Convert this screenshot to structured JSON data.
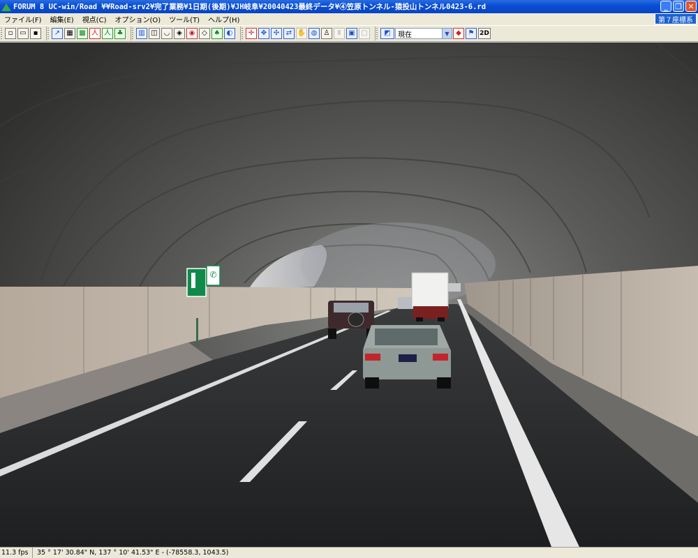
{
  "window": {
    "title": "FORUM 8    UC-win/Road    ¥¥Road-srv2¥完了業務¥1日期(後期)¥JH岐阜¥20040423最終データ¥④笠原トンネル-猿投山トンネル0423-6.rd",
    "icon": "forum8-logo-icon",
    "buttons": {
      "minimize": "_",
      "restore": "❐",
      "close": "✕"
    }
  },
  "menu": {
    "items": [
      "ファイル(F)",
      "編集(E)",
      "視点(C)",
      "オプション(O)",
      "ツール(T)",
      "ヘルプ(H)"
    ],
    "coordinate_system": "第７座標系"
  },
  "toolbar": {
    "view_select": {
      "value": "現在"
    },
    "mode_2d": "2D"
  },
  "viewport": {
    "scene": "tunnel",
    "colors": {
      "road": "#2a2b2c",
      "lane_marking": "#e8e8e8",
      "wall": "#c9bfb3",
      "sign": "#0f8a4a"
    }
  },
  "status": {
    "fps": "11.3 fps",
    "coordinates": "35 °   17' 30.84\" N, 137 °   10' 41.53\" E  -  (-78558.3, 1043.5)"
  }
}
